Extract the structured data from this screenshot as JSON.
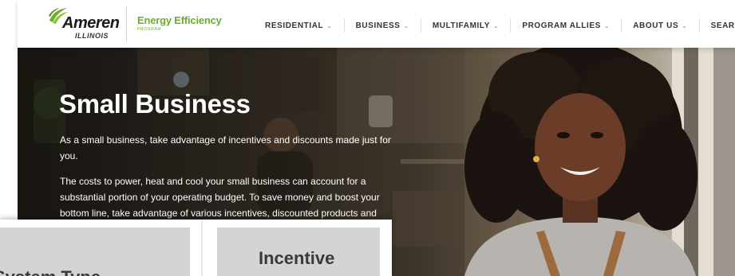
{
  "brand": {
    "name": "Ameren",
    "region": "ILLINOIS",
    "program_title": "Energy Efficiency",
    "program_sub": "PROGRAM",
    "colors": {
      "green": "#6cae2b",
      "dark": "#1a1a1a"
    }
  },
  "nav": {
    "items": [
      {
        "label": "RESIDENTIAL",
        "has_dropdown": true
      },
      {
        "label": "BUSINESS",
        "has_dropdown": true
      },
      {
        "label": "MULTIFAMILY",
        "has_dropdown": true
      },
      {
        "label": "PROGRAM ALLIES",
        "has_dropdown": true
      },
      {
        "label": "ABOUT US",
        "has_dropdown": true
      },
      {
        "label": "SEARCH",
        "has_dropdown": false
      }
    ],
    "dropdown_icon": "chevron-down-icon"
  },
  "hero": {
    "title": "Small Business",
    "paragraph1": "As a small business, take advantage of incentives and discounts made just for you.",
    "paragraph2": "The costs to power, heat and cool your small business can account for a substantial portion of your operating budget. To save money and boost your bottom line, take advantage of various incentives, discounted products and"
  },
  "table_fragment": {
    "col1": "System Type",
    "col2": "Incentive"
  }
}
